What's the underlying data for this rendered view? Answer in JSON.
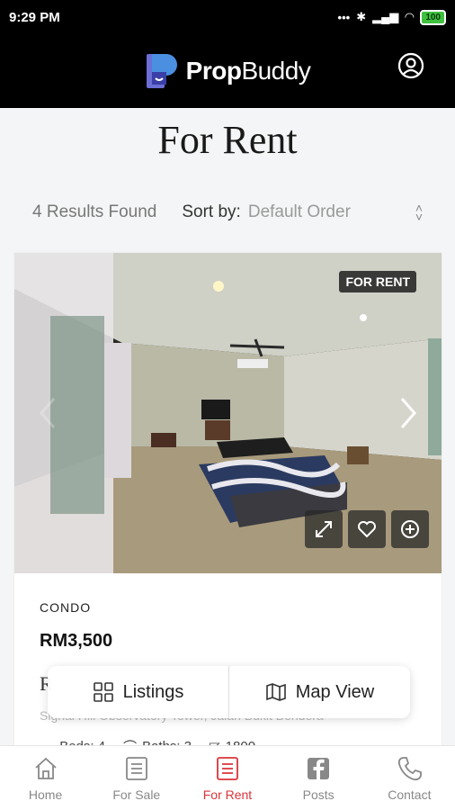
{
  "status_bar": {
    "time": "9:29 PM",
    "battery": "100"
  },
  "header": {
    "brand_bold": "Prop",
    "brand_light": "Buddy"
  },
  "page": {
    "title": "For Rent"
  },
  "results": {
    "count": "4 Results Found",
    "sort_label": "Sort by:",
    "sort_value": "Default Order"
  },
  "listing": {
    "badge": "FOR RENT",
    "type": "CONDO",
    "price": "RM3,500",
    "title_peek": "R",
    "address": "Signal Hill Observatory Tower, Jalan Bukit Bendera",
    "beds": "Beds: 4",
    "baths": "Baths: 3",
    "size": "1800"
  },
  "view_toggle": {
    "listings": "Listings",
    "map": "Map View"
  },
  "bottom_nav": [
    {
      "label": "Home"
    },
    {
      "label": "For Sale"
    },
    {
      "label": "For Rent"
    },
    {
      "label": "Posts"
    },
    {
      "label": "Contact"
    }
  ],
  "colors": {
    "accent": "#d9343a",
    "header_bg": "#000000"
  }
}
